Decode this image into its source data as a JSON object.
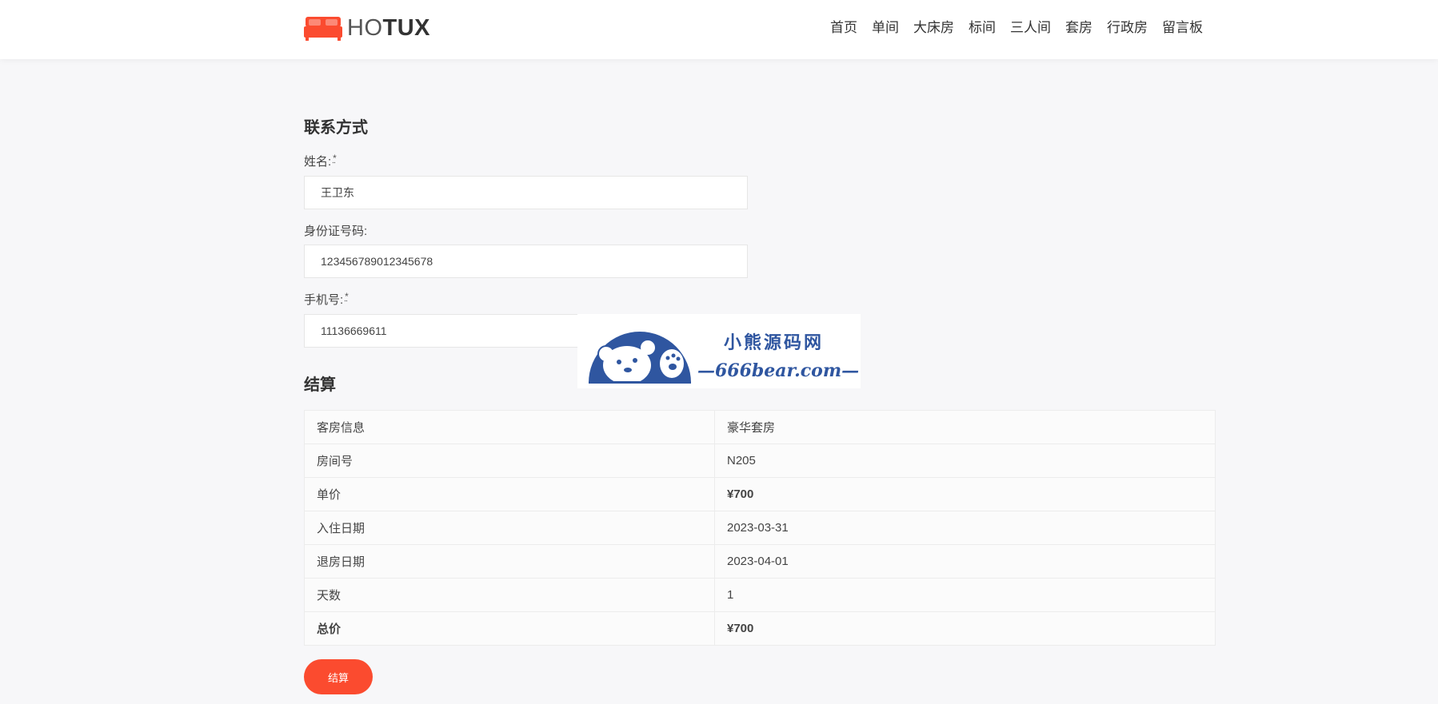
{
  "header": {
    "logo_light": "HO",
    "logo_bold": "TUX",
    "nav": [
      "首页",
      "单间",
      "大床房",
      "标间",
      "三人间",
      "套房",
      "行政房",
      "留言板"
    ]
  },
  "contact": {
    "title": "联系方式",
    "name_label": "姓名:",
    "name_required": "*",
    "name_value": "王卫东",
    "id_label": "身份证号码:",
    "id_value": "123456789012345678",
    "phone_label": "手机号:",
    "phone_required": "*",
    "phone_value": "11136669611"
  },
  "checkout": {
    "title": "结算",
    "rows": [
      {
        "label": "客房信息",
        "value": "豪华套房"
      },
      {
        "label": "房间号",
        "value": "N205"
      },
      {
        "label": "单价",
        "value": "¥700"
      },
      {
        "label": "入住日期",
        "value": "2023-03-31"
      },
      {
        "label": "退房日期",
        "value": "2023-04-01"
      },
      {
        "label": "天数",
        "value": "1"
      },
      {
        "label": "总价",
        "value": "¥700"
      }
    ],
    "button_label": "结算"
  },
  "watermark": {
    "cn": "小熊源码网",
    "en": "—666bear.com—"
  },
  "colors": {
    "accent": "#fb4b2f",
    "price": "#f04a2f",
    "watermark_blue": "#2f56a0"
  }
}
